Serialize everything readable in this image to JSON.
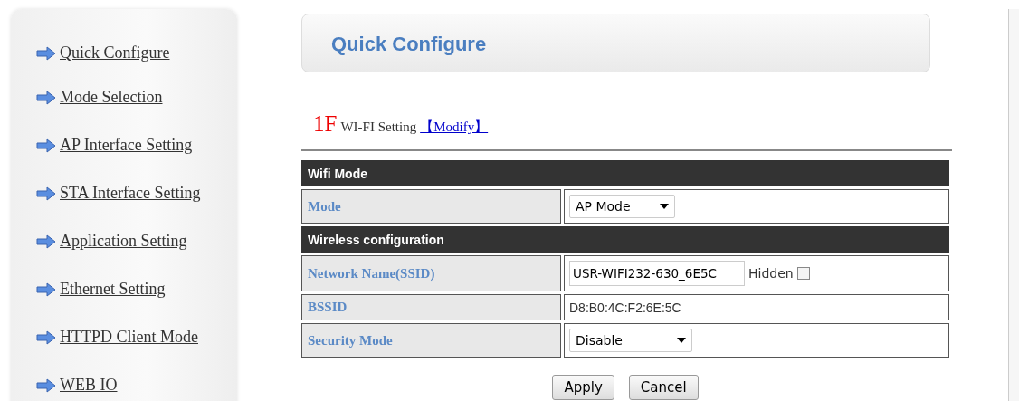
{
  "sidebar": {
    "items": [
      {
        "label": "Quick Configure"
      },
      {
        "label": "Mode Selection"
      },
      {
        "label": "AP Interface Setting"
      },
      {
        "label": "STA Interface Setting"
      },
      {
        "label": "Application Setting"
      },
      {
        "label": "Ethernet Setting"
      },
      {
        "label": "HTTPD Client Mode"
      },
      {
        "label": "WEB IO"
      }
    ]
  },
  "page_title": "Quick Configure",
  "section_heading": {
    "number": "1F",
    "title": "WI-FI Setting",
    "link": "【Modify】"
  },
  "table": {
    "sections": [
      {
        "title": "Wifi Mode",
        "rows": [
          {
            "label": "Mode",
            "kind": "select",
            "value": "AP Mode"
          }
        ]
      },
      {
        "title": "Wireless configuration",
        "rows": [
          {
            "label": "Network Name(SSID)",
            "kind": "input",
            "value": "USR-WIFI232-630_6E5C",
            "checkbox_label": "Hidden",
            "checked": false
          },
          {
            "label": "BSSID",
            "kind": "text",
            "value": "D8:B0:4C:F2:6E:5C"
          },
          {
            "label": "Security Mode",
            "kind": "select",
            "value": "Disable"
          }
        ]
      }
    ]
  },
  "buttons": [
    "Apply",
    "Cancel"
  ]
}
